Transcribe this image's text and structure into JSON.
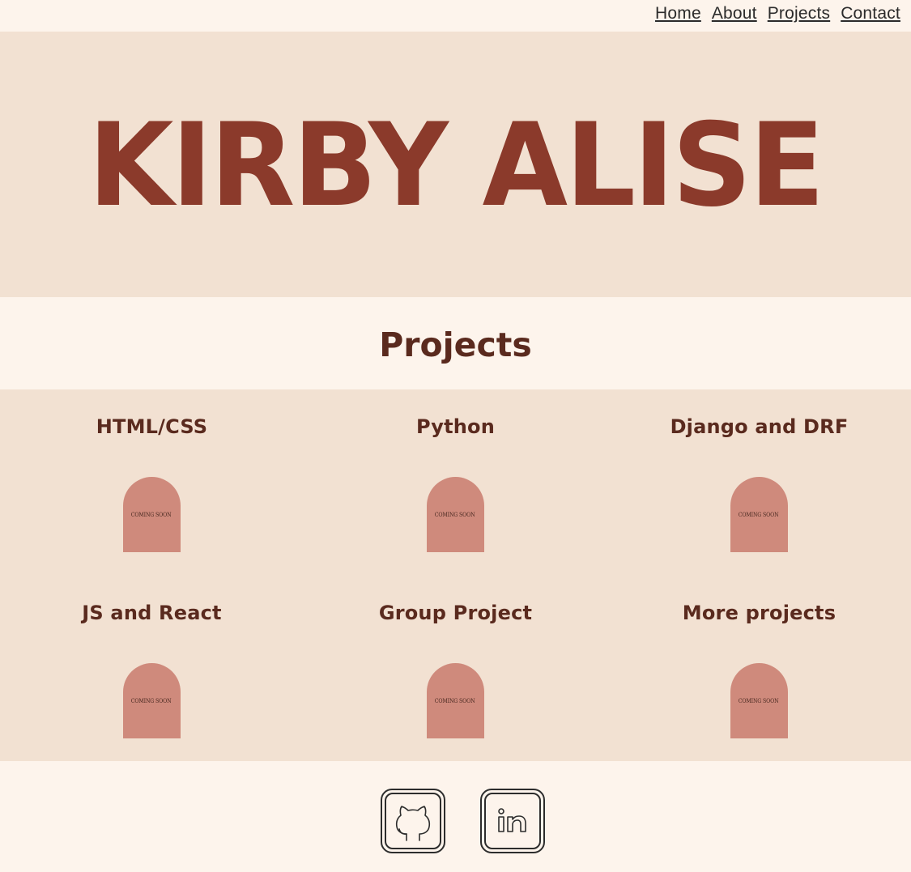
{
  "nav": {
    "items": [
      {
        "label": "Home"
      },
      {
        "label": "About"
      },
      {
        "label": "Projects"
      },
      {
        "label": "Contact"
      }
    ]
  },
  "hero": {
    "title": "KIRBY ALISE"
  },
  "projects": {
    "heading": "Projects",
    "cards": [
      {
        "title": "HTML/CSS",
        "badge": "COMING SOON"
      },
      {
        "title": "Python",
        "badge": "COMING SOON"
      },
      {
        "title": "Django and DRF",
        "badge": "COMING SOON"
      },
      {
        "title": "JS and React",
        "badge": "COMING SOON"
      },
      {
        "title": "Group Project",
        "badge": "COMING SOON"
      },
      {
        "title": "More projects",
        "badge": "COMING SOON"
      }
    ]
  },
  "footer": {
    "icons": [
      "github-icon",
      "linkedin-icon"
    ]
  },
  "colors": {
    "background": "#fdf4ec",
    "band": "#f2e1d2",
    "brand": "#8b3a2b",
    "heading": "#5a2a1e",
    "arch": "#cf8a7c"
  }
}
